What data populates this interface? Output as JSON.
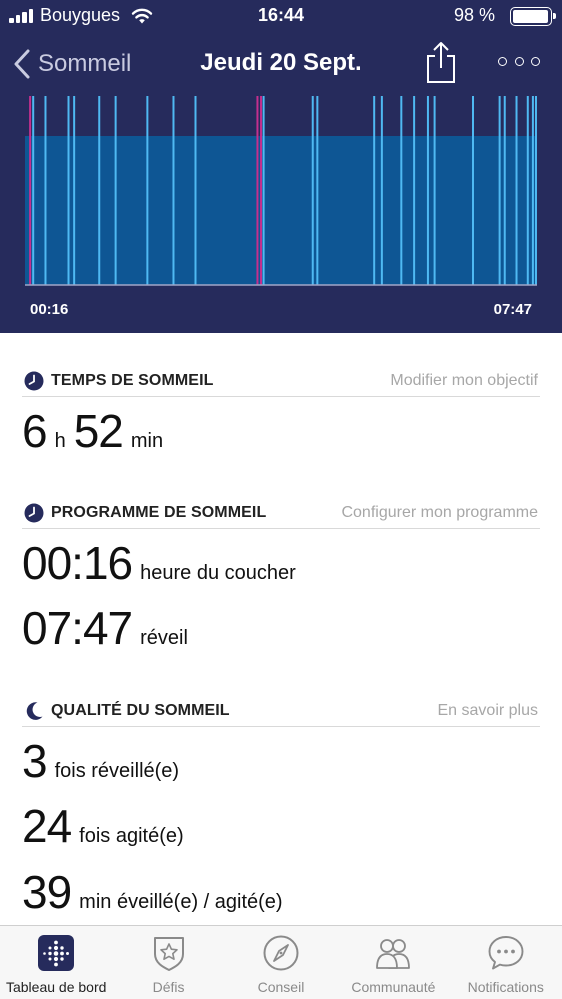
{
  "status_bar": {
    "carrier": "Bouygues",
    "time": "16:44",
    "battery_text": "98 %",
    "battery_level": 0.98
  },
  "nav": {
    "back_label": "Sommeil",
    "title": "Jeudi 20 Sept.",
    "share_icon": "share-icon",
    "more_icon": "more-icon"
  },
  "chart_data": {
    "type": "area",
    "title": "",
    "xlabel": "",
    "ylabel": "",
    "x_start_label": "00:16",
    "x_end_label": "07:47",
    "colors": {
      "background": "#262b5c",
      "asleep": "#0e5694",
      "awake": "#4fb9f2",
      "restless": "#c42f8e",
      "baseline": "#a0a6c8"
    },
    "asleep_band": {
      "start": 0.0,
      "end": 1.0
    },
    "events": [
      {
        "x": 0.01,
        "kind": "restless"
      },
      {
        "x": 0.016,
        "kind": "awake"
      },
      {
        "x": 0.04,
        "kind": "awake"
      },
      {
        "x": 0.085,
        "kind": "awake"
      },
      {
        "x": 0.096,
        "kind": "awake"
      },
      {
        "x": 0.145,
        "kind": "awake"
      },
      {
        "x": 0.177,
        "kind": "awake"
      },
      {
        "x": 0.239,
        "kind": "awake"
      },
      {
        "x": 0.29,
        "kind": "awake"
      },
      {
        "x": 0.333,
        "kind": "awake"
      },
      {
        "x": 0.454,
        "kind": "restless"
      },
      {
        "x": 0.461,
        "kind": "restless"
      },
      {
        "x": 0.466,
        "kind": "awake"
      },
      {
        "x": 0.562,
        "kind": "awake"
      },
      {
        "x": 0.571,
        "kind": "awake"
      },
      {
        "x": 0.682,
        "kind": "awake"
      },
      {
        "x": 0.697,
        "kind": "awake"
      },
      {
        "x": 0.735,
        "kind": "awake"
      },
      {
        "x": 0.76,
        "kind": "awake"
      },
      {
        "x": 0.787,
        "kind": "awake"
      },
      {
        "x": 0.8,
        "kind": "awake"
      },
      {
        "x": 0.875,
        "kind": "awake"
      },
      {
        "x": 0.927,
        "kind": "awake"
      },
      {
        "x": 0.937,
        "kind": "awake"
      },
      {
        "x": 0.96,
        "kind": "awake"
      },
      {
        "x": 0.982,
        "kind": "awake"
      },
      {
        "x": 0.992,
        "kind": "awake"
      },
      {
        "x": 0.998,
        "kind": "awake"
      }
    ]
  },
  "sections": {
    "sleep_time": {
      "title": "TEMPS DE SOMMEIL",
      "link": "Modifier mon objectif",
      "hours": "6",
      "hours_unit": "h",
      "minutes": "52",
      "minutes_unit": "min"
    },
    "schedule": {
      "title": "PROGRAMME DE SOMMEIL",
      "link": "Configurer mon programme",
      "bedtime_value": "00:16",
      "bedtime_label": "heure du coucher",
      "wake_value": "07:47",
      "wake_label": "réveil"
    },
    "quality": {
      "title": "QUALITÉ DU SOMMEIL",
      "link": "En savoir plus",
      "awakenings_value": "3",
      "awakenings_label": "fois réveillé(e)",
      "restless_value": "24",
      "restless_label": "fois agité(e)",
      "awake_minutes_value": "39",
      "awake_minutes_label": "min éveillé(e) / agité(e)"
    }
  },
  "tabbar": {
    "tabs": [
      {
        "label": "Tableau de bord",
        "icon": "dashboard-icon",
        "active": true
      },
      {
        "label": "Défis",
        "icon": "challenges-badge-icon",
        "active": false
      },
      {
        "label": "Conseil",
        "icon": "compass-icon",
        "active": false
      },
      {
        "label": "Communauté",
        "icon": "community-people-icon",
        "active": false
      },
      {
        "label": "Notifications",
        "icon": "chat-bubble-icon",
        "active": false
      }
    ]
  }
}
